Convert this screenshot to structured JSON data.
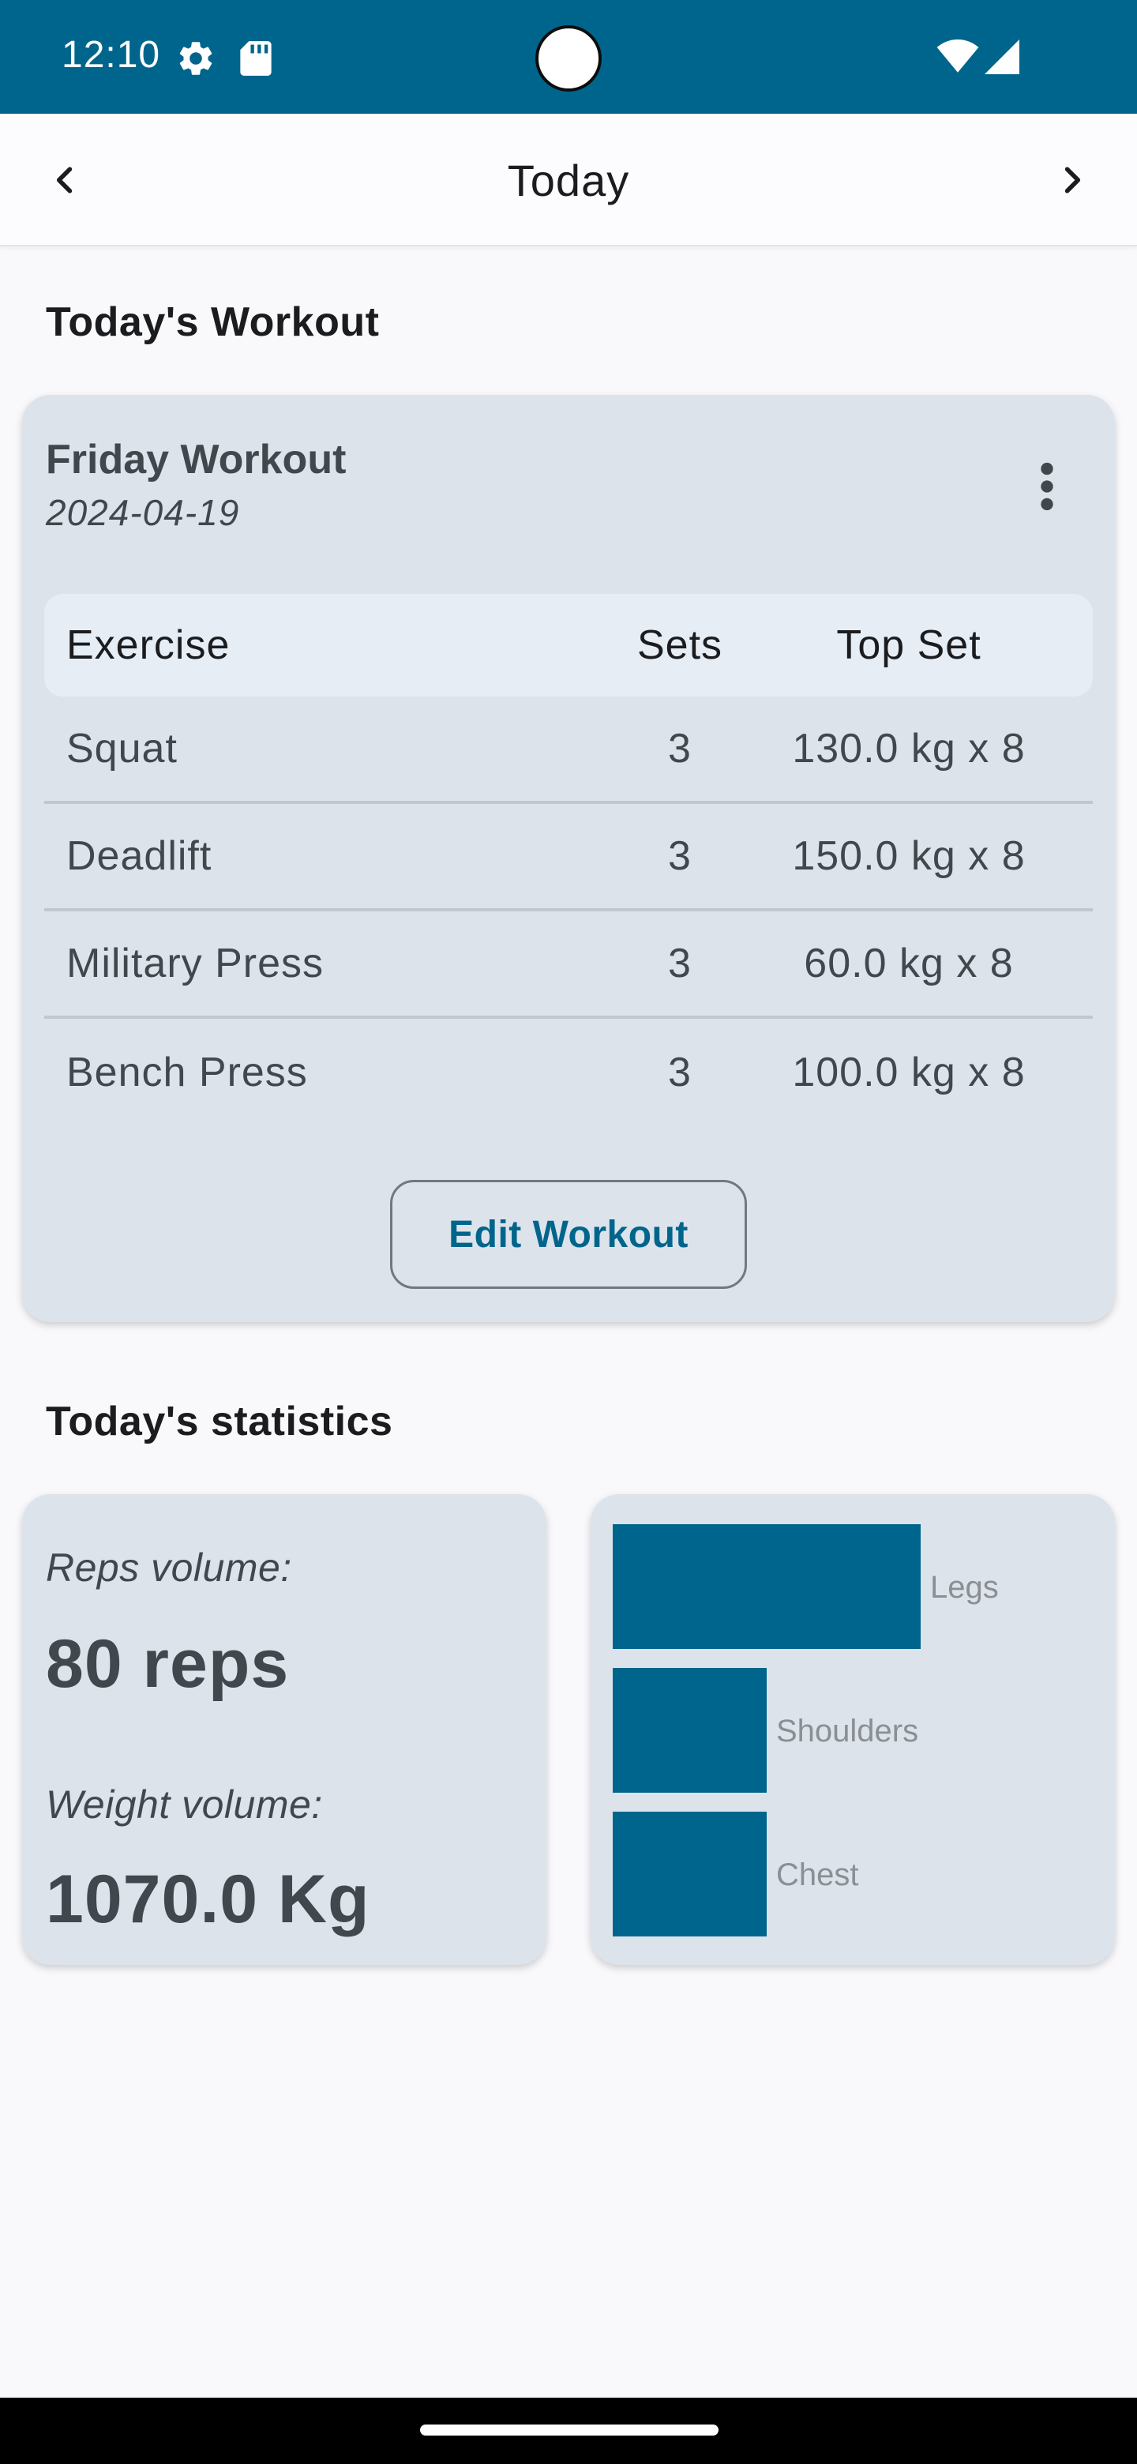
{
  "status_bar": {
    "time": "12:10",
    "icons": [
      "gear-icon",
      "sd-card-icon",
      "wifi-icon",
      "signal-icon"
    ],
    "background": "#00658c"
  },
  "app_bar": {
    "title": "Today",
    "prev_icon": "chevron-left-icon",
    "next_icon": "chevron-right-icon"
  },
  "workout_section": {
    "title": "Today's Workout",
    "card": {
      "name": "Friday Workout",
      "date": "2024-04-19",
      "menu_icon": "more-vert-icon",
      "table": {
        "headers": {
          "exercise": "Exercise",
          "sets": "Sets",
          "top_set": "Top Set"
        },
        "rows": [
          {
            "exercise": "Squat",
            "sets": "3",
            "top_set": "130.0 kg x 8"
          },
          {
            "exercise": "Deadlift",
            "sets": "3",
            "top_set": "150.0 kg x 8"
          },
          {
            "exercise": "Military Press",
            "sets": "3",
            "top_set": "60.0 kg x 8"
          },
          {
            "exercise": "Bench Press",
            "sets": "3",
            "top_set": "100.0 kg x 8"
          }
        ]
      },
      "edit_button": "Edit Workout"
    }
  },
  "statistics_section": {
    "title": "Today's statistics",
    "reps_volume_label": "Reps volume:",
    "reps_volume_value": "80 reps",
    "weight_volume_label": "Weight volume:",
    "weight_volume_value": "1070.0 Kg"
  },
  "chart_data": {
    "type": "bar",
    "orientation": "horizontal",
    "categories": [
      "Legs",
      "Shoulders",
      "Chest"
    ],
    "values": [
      2,
      1,
      1
    ],
    "bar_color": "#00658c",
    "xlabel": "",
    "ylabel": "",
    "grid": false,
    "legend": "none"
  },
  "colors": {
    "primary": "#00658c",
    "card": "#dde3ea",
    "background": "#f9f9fc",
    "on_surface_variant": "#41484d"
  }
}
